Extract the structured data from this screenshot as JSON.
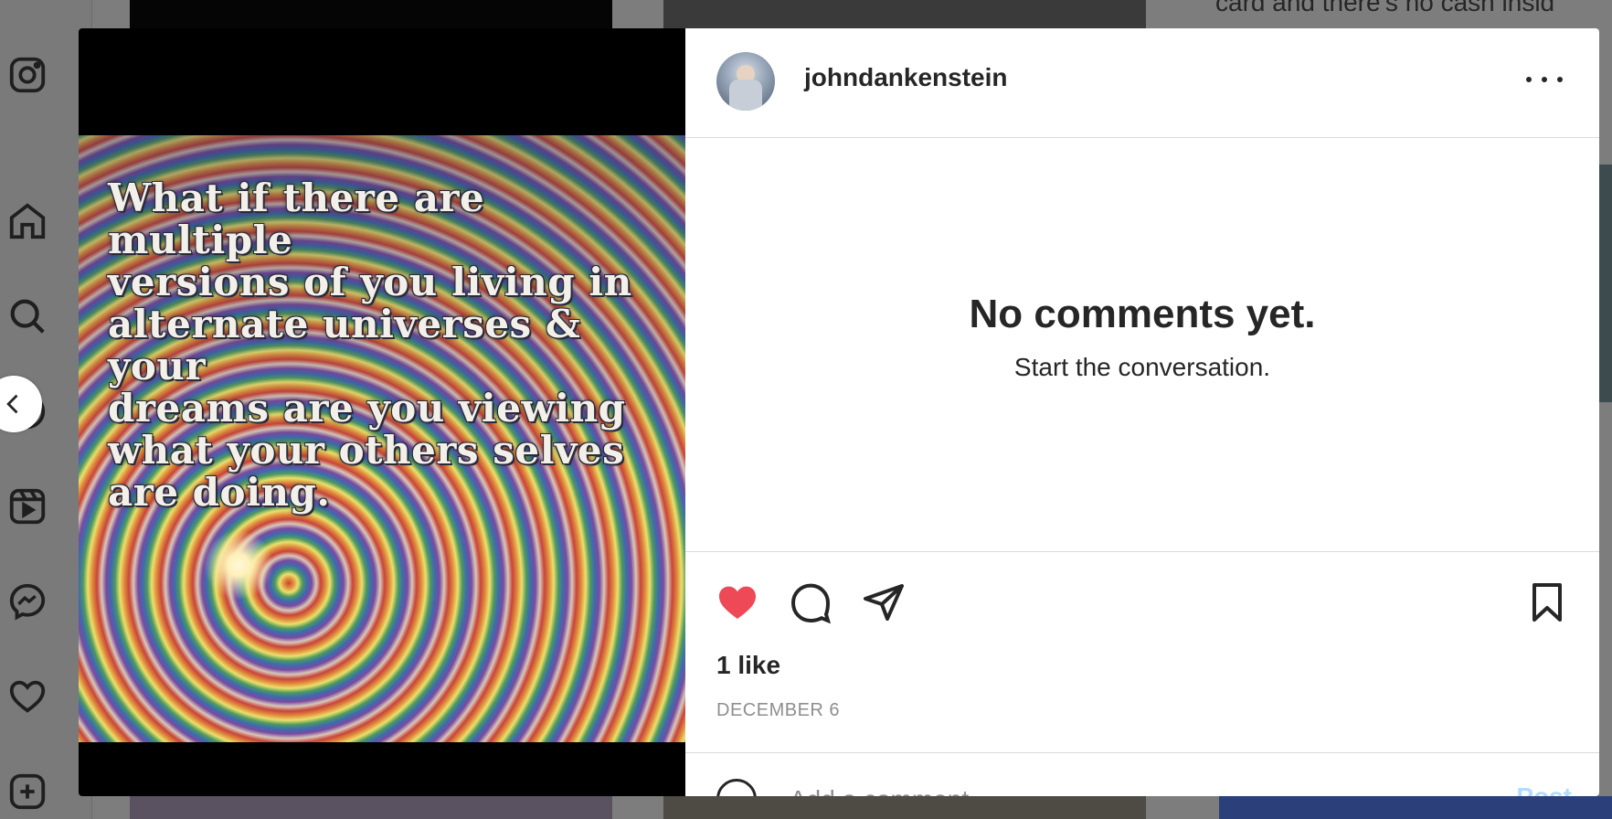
{
  "post": {
    "username": "johndankenstein",
    "image_text": "What if there are multiple\nversions of you living in\nalternate universes & your\ndreams are you viewing\nwhat your others selves\nare doing.",
    "no_comments_title": "No comments yet.",
    "no_comments_subtitle": "Start the conversation.",
    "likes": "1 like",
    "date": "DECEMBER 6",
    "liked": true,
    "like_color": "#ed4956"
  },
  "comment_box": {
    "placeholder": "Add a comment...",
    "post_label": "Post"
  },
  "background": {
    "partial_text": "card and there's no cash insid"
  },
  "sidebar": {
    "icons": [
      "instagram-icon",
      "home-icon",
      "search-icon",
      "explore-icon",
      "reels-icon",
      "messenger-icon",
      "heart-icon",
      "create-icon"
    ]
  },
  "icons": {
    "more": "more-options-icon",
    "like": "heart-filled-icon",
    "comment": "comment-icon",
    "share": "share-icon",
    "save": "bookmark-icon",
    "emoji": "emoji-icon",
    "prev": "chevron-left-icon"
  }
}
